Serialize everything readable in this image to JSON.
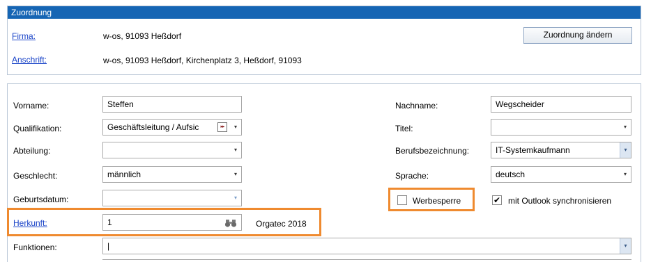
{
  "zuordnung": {
    "title": "Zuordnung",
    "firma_label": "Firma:",
    "firma_value": "w-os, 91093 Heßdorf",
    "anschrift_label": "Anschrift:",
    "anschrift_value": "w-os, 91093 Heßdorf, Kirchenplatz 3, Heßdorf, 91093",
    "change_button": "Zuordnung ändern"
  },
  "form": {
    "vorname_label": "Vorname:",
    "vorname_value": "Steffen",
    "qualifikation_label": "Qualifikation:",
    "qualifikation_value": "Geschäftsleitung / Aufsic",
    "abteilung_label": "Abteilung:",
    "abteilung_value": "",
    "geschlecht_label": "Geschlecht:",
    "geschlecht_value": "männlich",
    "geburtsdatum_label": "Geburtsdatum:",
    "geburtsdatum_value": "",
    "herkunft_label": "Herkunft:",
    "herkunft_value": "1",
    "herkunft_text": "Orgatec 2018",
    "funktionen_label": "Funktionen:",
    "funktionen_value": "|",
    "nachname_label": "Nachname:",
    "nachname_value": "Wegscheider",
    "titel_label": "Titel:",
    "titel_value": "",
    "berufsbezeichnung_label": "Berufsbezeichnung:",
    "berufsbezeichnung_value": "IT-Systemkaufmann",
    "sprache_label": "Sprache:",
    "sprache_value": "deutsch",
    "werbesperre_label": "Werbesperre",
    "werbesperre_checked": false,
    "outlook_label": "mit Outlook synchronisieren",
    "outlook_checked": true
  },
  "icons": {
    "dropdown": "▾",
    "check": "✔",
    "fast_forward": "▸▸",
    "binoculars": "binoculars-icon"
  },
  "colors": {
    "header_blue": "#1565b4",
    "link_blue": "#1a44c8",
    "highlight_orange": "#ef8a2f"
  }
}
